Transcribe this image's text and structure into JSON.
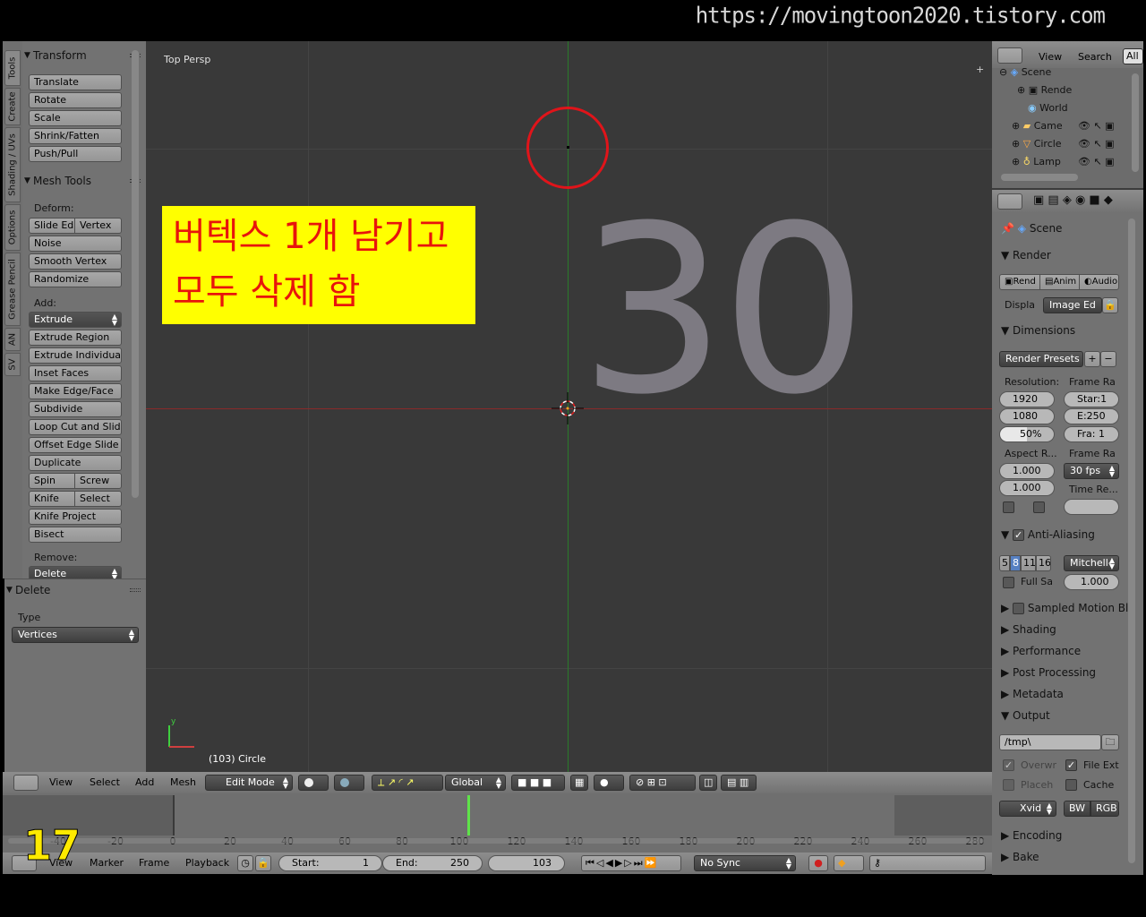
{
  "watermark": "https://movingtoon2020.tistory.com",
  "step_number": "17",
  "annotation": {
    "line1": "버텍스 1개 남기고",
    "line2": "모두 삭제 함",
    "bg_color": "#ffff00",
    "text_color": "#e8140c"
  },
  "left_tabs": [
    "Tools",
    "Create",
    "Shading / UVs",
    "Options",
    "Grease Pencil",
    "AN",
    "SV"
  ],
  "tool_panel": {
    "transform_header": "Transform",
    "transform_buttons": [
      "Translate",
      "Rotate",
      "Scale",
      "Shrink/Fatten",
      "Push/Pull"
    ],
    "mesh_tools_header": "Mesh Tools",
    "deform_label": "Deform:",
    "slide_edge": "Slide Ed",
    "slide_vertex": "Vertex",
    "deform_buttons": [
      "Noise",
      "Smooth Vertex",
      "Randomize"
    ],
    "add_label": "Add:",
    "extrude": "Extrude",
    "add_buttons": [
      "Extrude Region",
      "Extrude Individual",
      "Inset Faces",
      "Make Edge/Face",
      "Subdivide",
      "Loop Cut and Slide",
      "Offset Edge Slide",
      "Duplicate"
    ],
    "spin": "Spin",
    "screw": "Screw",
    "knife": "Knife",
    "knife_select": "Select",
    "knife_project": "Knife Project",
    "bisect": "Bisect",
    "remove_label": "Remove:",
    "delete_btn": "Delete"
  },
  "delete_panel": {
    "header": "Delete",
    "type_label": "Type",
    "type_value": "Vertices"
  },
  "viewport": {
    "view_name": "Top Persp",
    "object_info": "(103) Circle",
    "big_text": "30",
    "highlight_color": "#e0141a"
  },
  "viewport_header": {
    "menus": [
      "View",
      "Select",
      "Add",
      "Mesh"
    ],
    "mode": "Edit Mode",
    "orientation": "Global"
  },
  "outliner": {
    "menus": [
      "View",
      "Search",
      "All"
    ],
    "items": [
      {
        "label": "Scene",
        "icon": "scene-icon"
      },
      {
        "label": "Rende",
        "icon": "render-layers-icon"
      },
      {
        "label": "World",
        "icon": "world-icon"
      },
      {
        "label": "Came",
        "icon": "camera-icon"
      },
      {
        "label": "Circle",
        "icon": "mesh-icon"
      },
      {
        "label": "Lamp",
        "icon": "lamp-icon"
      }
    ]
  },
  "properties": {
    "scene_label": "Scene",
    "render_header": "Render",
    "render_buttons": [
      "Rend",
      "Anim",
      "Audio"
    ],
    "display_label": "Displa",
    "display_value": "Image Ed",
    "dimensions_header": "Dimensions",
    "render_presets": "Render Presets",
    "resolution_label": "Resolution:",
    "frame_range_label": "Frame Ra",
    "res_x": "1920",
    "res_y": "1080",
    "res_pct": "50%",
    "frame_start": "Star:1",
    "frame_end": "E:250",
    "frame_step": "Fra: 1",
    "aspect_label": "Aspect R...",
    "frame_rate_label": "Frame Ra",
    "aspect_x": "1.000",
    "aspect_y": "1.000",
    "fps": "30 fps",
    "time_remap_label": "Time Re...",
    "aa_header": "Anti-Aliasing",
    "aa_samples": [
      "5",
      "8",
      "11",
      "16"
    ],
    "aa_filter": "Mitchell-",
    "full_sample": "Full Sa",
    "filter_size": "1.000",
    "motion_blur": "Sampled Motion Bl",
    "shading": "Shading",
    "performance": "Performance",
    "post_processing": "Post Processing",
    "metadata": "Metadata",
    "output_header": "Output",
    "output_path": "/tmp\\",
    "overwrite": "Overwr",
    "file_ext": "File Ext",
    "placeholders": "Placeh",
    "cache": "Cache",
    "format": "Xvid",
    "bw": "BW",
    "rgb": "RGB",
    "encoding": "Encoding",
    "bake": "Bake"
  },
  "timeline": {
    "ruler": [
      "-40",
      "-20",
      "0",
      "20",
      "40",
      "60",
      "80",
      "100",
      "120",
      "140",
      "160",
      "180",
      "200",
      "220",
      "240",
      "260",
      "280"
    ],
    "current_frame_marker": 103,
    "menus": [
      "View",
      "Marker",
      "Frame",
      "Playback"
    ],
    "start_label": "Start:",
    "start_value": "1",
    "end_label": "End:",
    "end_value": "250",
    "current_frame": "103",
    "sync": "No Sync"
  },
  "colors": {
    "x_axis": "#8a2a2a",
    "y_axis": "#2a7a2a",
    "playhead": "#5fe34a"
  }
}
